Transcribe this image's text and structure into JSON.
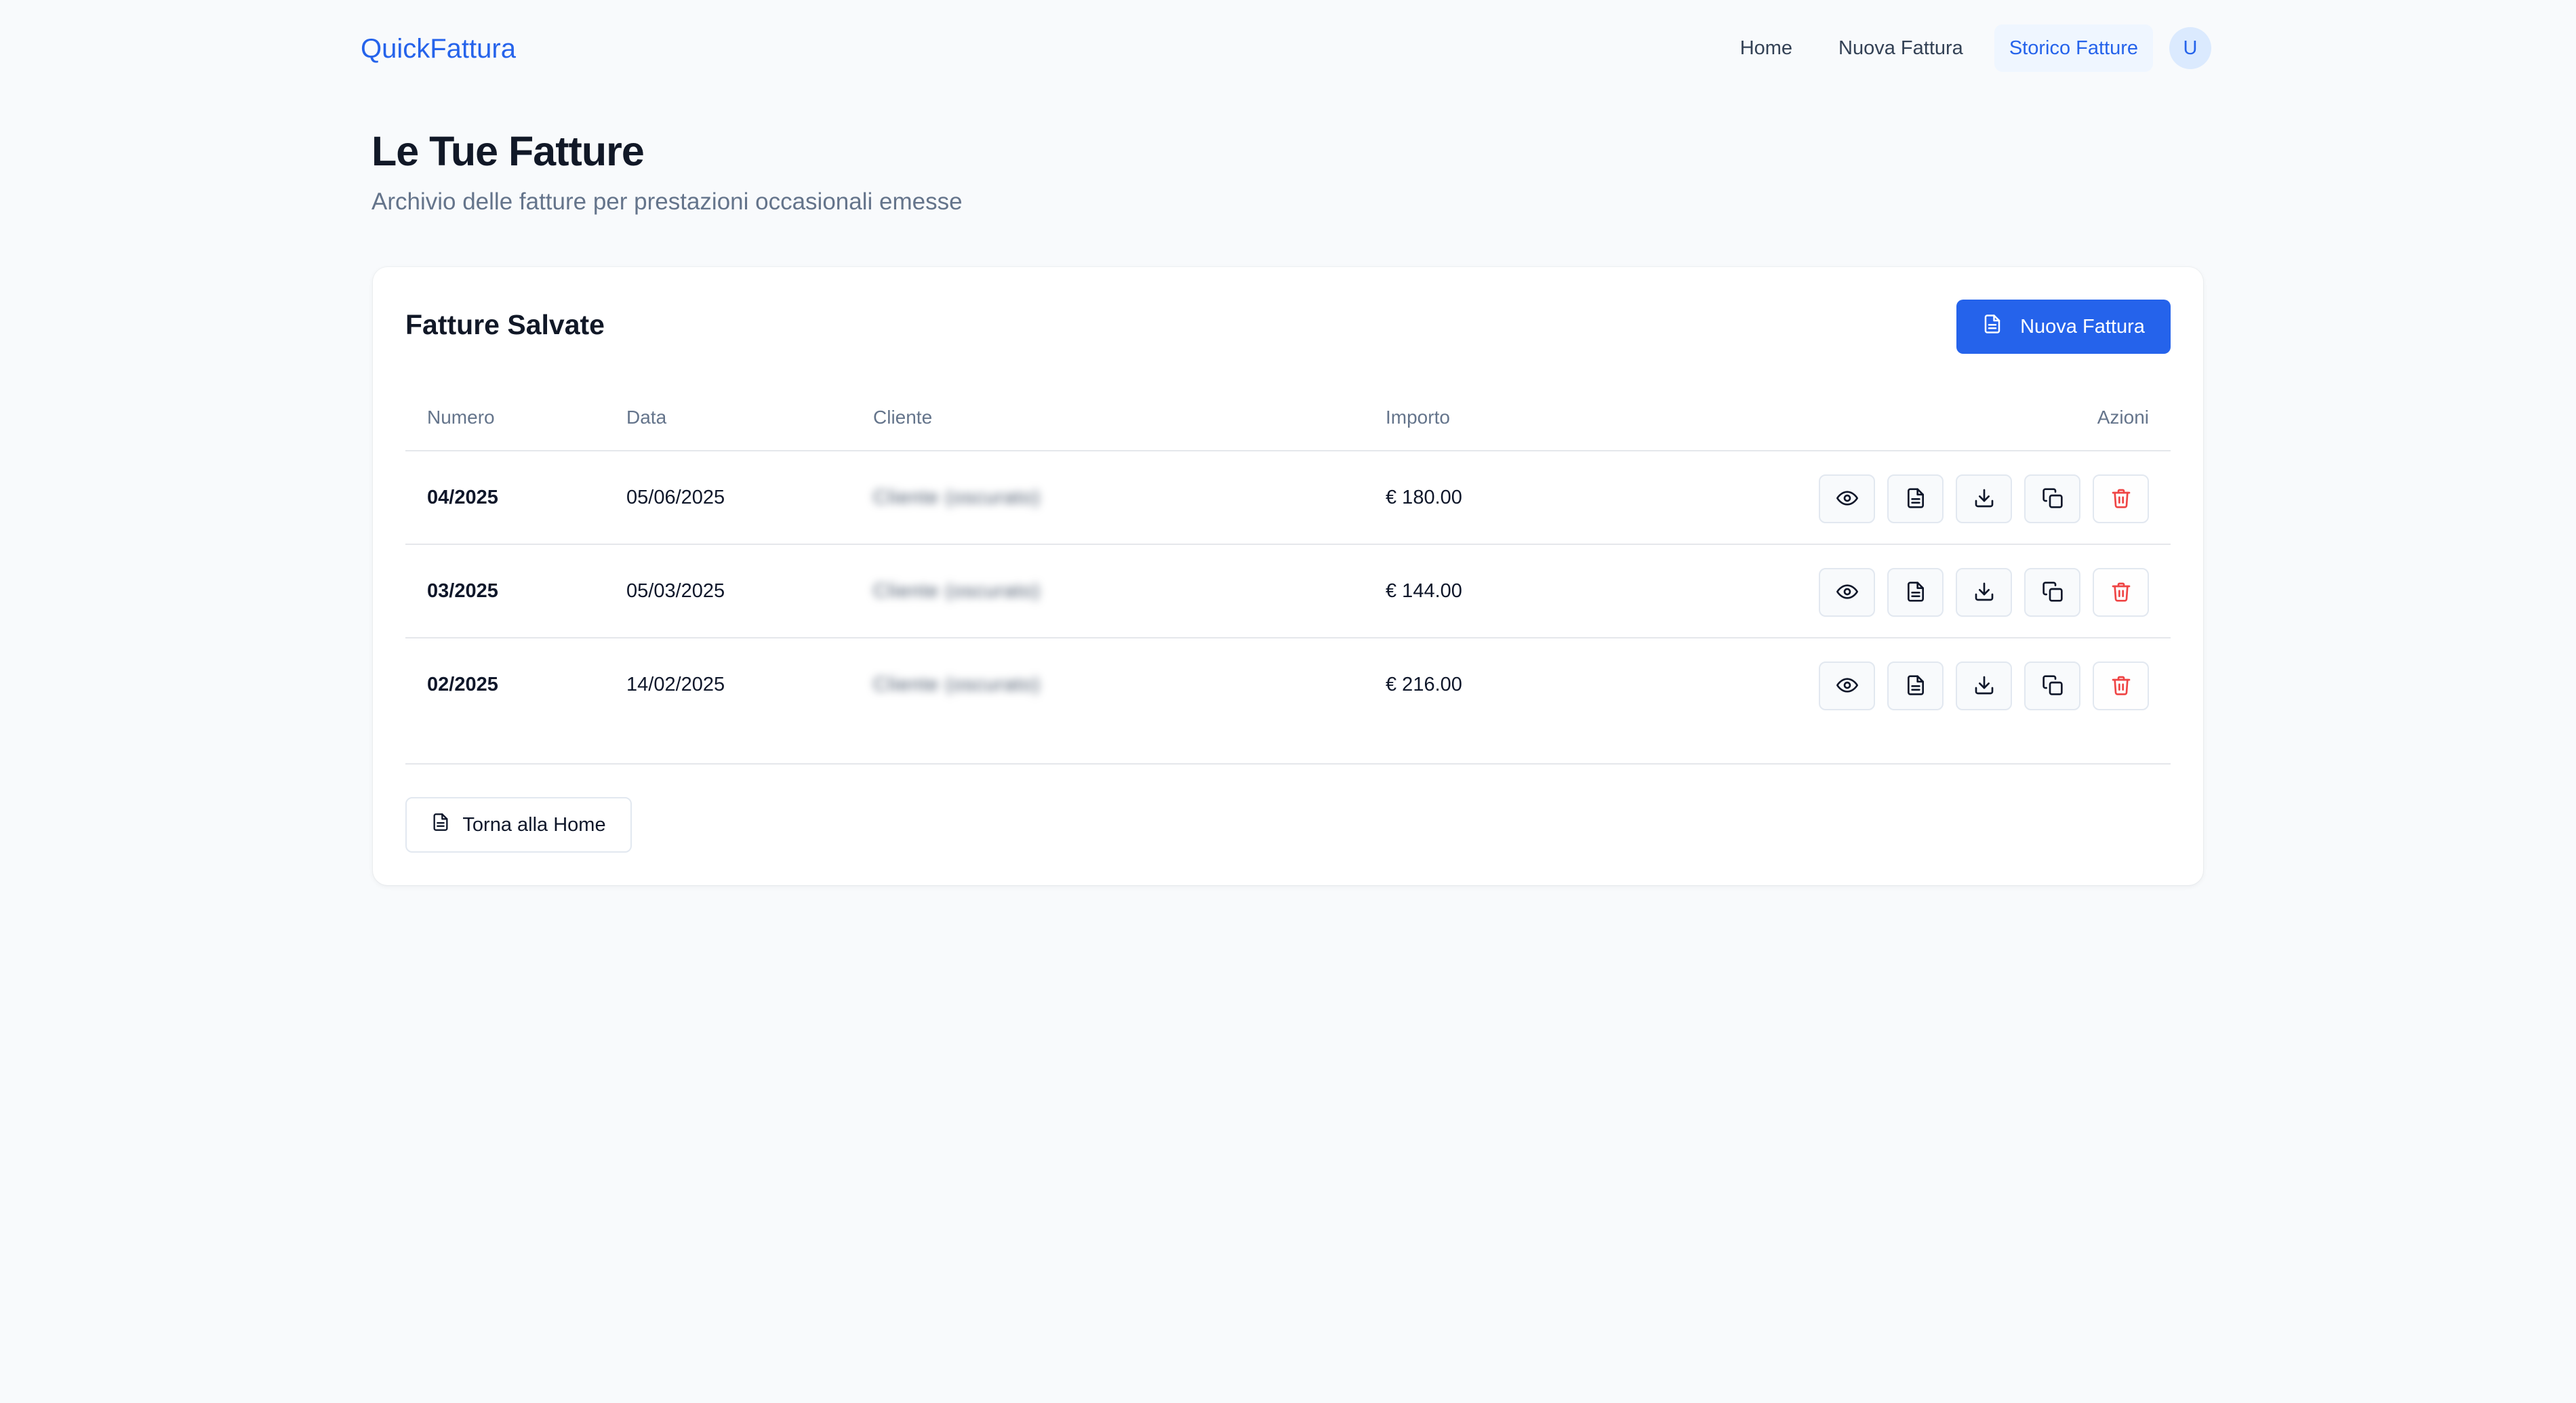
{
  "app": {
    "brand": "QuickFattura"
  },
  "nav": {
    "items": [
      {
        "label": "Home"
      },
      {
        "label": "Nuova Fattura"
      },
      {
        "label": "Storico Fatture",
        "active": true
      }
    ],
    "avatar": "U"
  },
  "page": {
    "title": "Le Tue Fatture",
    "subtitle": "Archivio delle fatture per prestazioni occasionali emesse"
  },
  "card": {
    "title": "Fatture Salvate",
    "new_button": "Nuova Fattura",
    "back_button": "Torna alla Home"
  },
  "table": {
    "headers": {
      "numero": "Numero",
      "data": "Data",
      "cliente": "Cliente",
      "importo": "Importo",
      "azioni": "Azioni"
    },
    "rows": [
      {
        "numero": "04/2025",
        "data": "05/06/2025",
        "cliente": "Cliente (oscurato)",
        "importo": "€ 180.00"
      },
      {
        "numero": "03/2025",
        "data": "05/03/2025",
        "cliente": "Cliente (oscurato)",
        "importo": "€ 144.00"
      },
      {
        "numero": "02/2025",
        "data": "14/02/2025",
        "cliente": "Cliente (oscurato)",
        "importo": "€ 216.00"
      }
    ],
    "row_actions": [
      "view-icon",
      "document-icon",
      "download-icon",
      "copy-icon",
      "trash-icon"
    ]
  },
  "colors": {
    "accent": "#2563eb",
    "danger": "#ef4444",
    "background": "#f8fafc",
    "muted_text": "#64748b"
  }
}
